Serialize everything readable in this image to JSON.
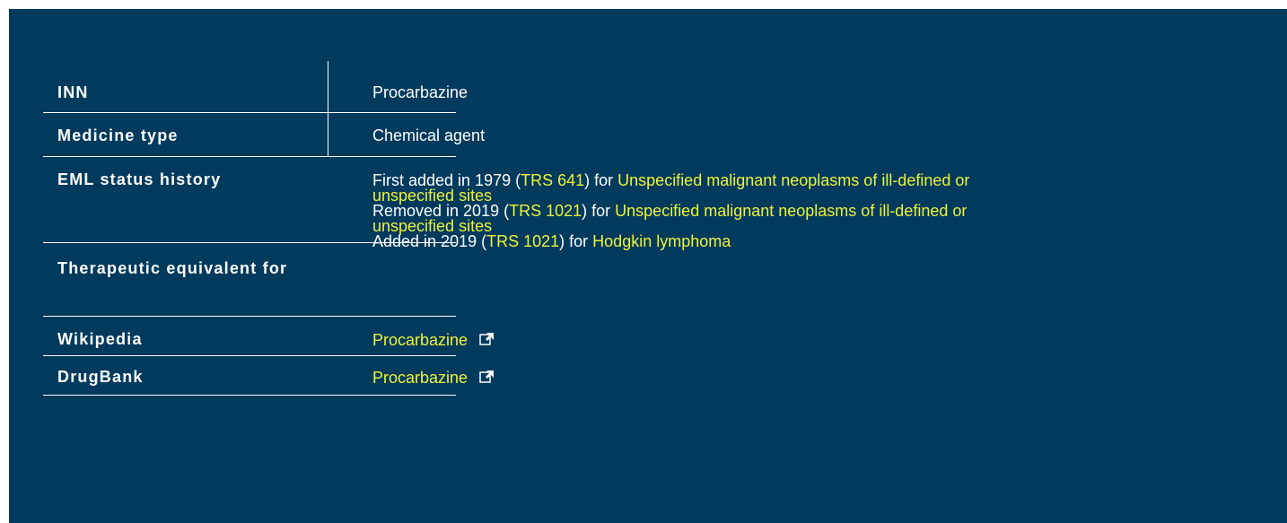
{
  "rows": {
    "inn": {
      "label": "INN",
      "value": "Procarbazine"
    },
    "medicine_type": {
      "label": "Medicine type",
      "value": "Chemical agent"
    },
    "eml_history": {
      "label": "EML status history",
      "entries": [
        {
          "prefix": "First added in 1979 (",
          "trs_link": "TRS 641",
          "mid": ") for ",
          "indication_link": "Unspecified malignant neoplasms of ill-defined or",
          "indication_link_cont": "unspecified sites"
        },
        {
          "prefix": "Removed in 2019 (",
          "trs_link": "TRS 1021",
          "mid": ") for ",
          "indication_link": "Unspecified malignant neoplasms of ill-defined or",
          "indication_link_cont": "unspecified sites"
        },
        {
          "prefix": "Added in 2019 (",
          "trs_link": "TRS 1021",
          "mid": ") for ",
          "indication_link": "Hodgkin lymphoma"
        }
      ]
    },
    "therapeutic_equivalent": {
      "label": "Therapeutic equivalent for",
      "value": ""
    },
    "wikipedia": {
      "label": "Wikipedia",
      "link": "Procarbazine",
      "icon": "external-link-icon"
    },
    "drugbank": {
      "label": "DrugBank",
      "link": "Procarbazine",
      "icon": "external-link-icon"
    }
  },
  "colors": {
    "background": "#003a5d",
    "text": "#ffffff",
    "link": "#f0f23a"
  }
}
